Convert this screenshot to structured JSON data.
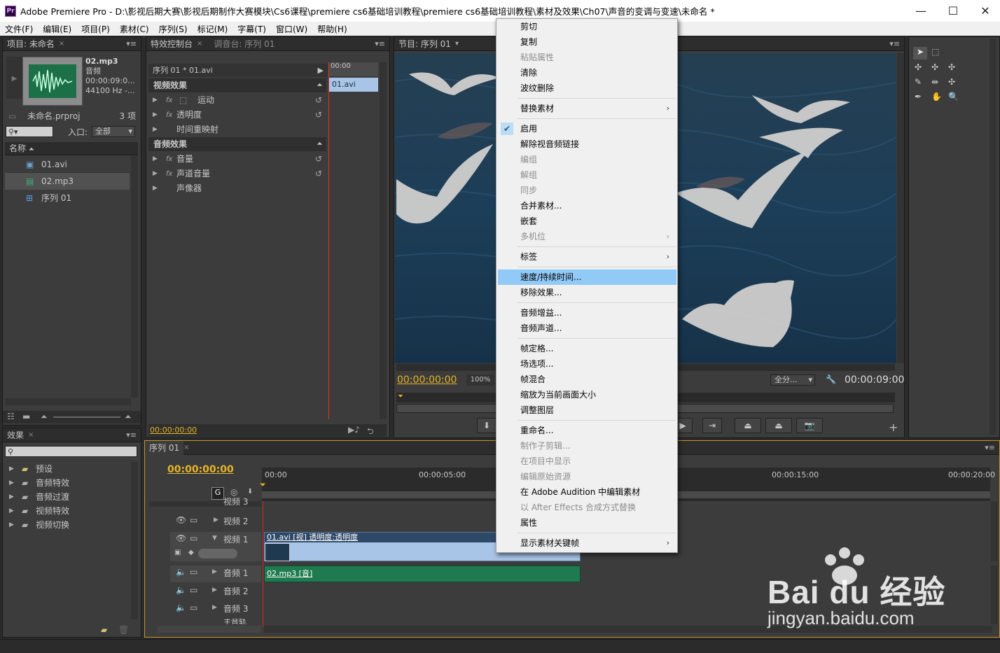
{
  "app": {
    "title": "Adobe Premiere Pro - D:\\影视后期大赛\\影视后期制作大赛模块\\Cs6课程\\premiere cs6基础培训教程\\premiere cs6基础培训教程\\素材及效果\\Ch07\\声音的变调与变速\\未命名 *",
    "logo": "Pr"
  },
  "menubar": [
    "文件(F)",
    "编辑(E)",
    "项目(P)",
    "素材(C)",
    "序列(S)",
    "标记(M)",
    "字幕(T)",
    "窗口(W)",
    "帮助(H)"
  ],
  "project_panel": {
    "tab": "项目: 未命名",
    "preview": {
      "name": "02.mp3",
      "type": "音频",
      "duration": "00:00:09:0...",
      "rate": "44100 Hz -..."
    },
    "project_file": "未命名.prproj",
    "item_count": "3 项",
    "entry_label": "入口:",
    "entry_value": "全部",
    "column_header": "名称",
    "items": [
      "01.avi",
      "02.mp3",
      "序列 01"
    ]
  },
  "effect_controls": {
    "tab": "特效控制台",
    "tab2": "调音台: 序列 01",
    "clip_path": "序列 01 * 01.avi",
    "timecode_ruler": "00:00",
    "clip_label": "01.avi",
    "video_header": "视频效果",
    "video_effects": [
      "运动",
      "透明度",
      "时间重映射"
    ],
    "audio_header": "音频效果",
    "audio_effects": [
      "音量",
      "声道音量",
      "声像器"
    ],
    "timecode": "00:00:00:00"
  },
  "program_monitor": {
    "tab": "节目: 序列 01",
    "timecode_left": "00:00:00:00",
    "zoom": "100%",
    "fit": "全分...",
    "timecode_right": "00:00:09:00"
  },
  "effects_panel": {
    "tab": "效果",
    "folders": [
      "预设",
      "音频特效",
      "音频过渡",
      "视频特效",
      "视频切换"
    ]
  },
  "timeline": {
    "tab": "序列 01",
    "timecode": "00:00:00:00",
    "ruler": [
      "00:00",
      "00:00:05:00",
      "00:00:15:00",
      "00:00:20:00"
    ],
    "tracks": [
      "视频 3",
      "视频 2",
      "视频 1",
      "音频 1",
      "音频 2",
      "音频 3",
      "主音轨"
    ],
    "video_clip": "01.avi [视] 透明度:透明度",
    "audio_clip": "02.mp3 [音]"
  },
  "context_menu": [
    {
      "label": "剪切",
      "enabled": true
    },
    {
      "label": "复制",
      "enabled": true
    },
    {
      "label": "粘贴属性",
      "enabled": false
    },
    {
      "label": "清除",
      "enabled": true
    },
    {
      "label": "波纹删除",
      "enabled": true
    },
    {
      "label": "替换素材",
      "enabled": true,
      "submenu": true
    },
    {
      "label": "启用",
      "enabled": true,
      "checked": true
    },
    {
      "label": "解除视音频链接",
      "enabled": true
    },
    {
      "label": "编组",
      "enabled": false
    },
    {
      "label": "解组",
      "enabled": false
    },
    {
      "label": "同步",
      "enabled": false
    },
    {
      "label": "合并素材...",
      "enabled": true
    },
    {
      "label": "嵌套",
      "enabled": true
    },
    {
      "label": "多机位",
      "enabled": false,
      "submenu": true
    },
    {
      "label": "标签",
      "enabled": true,
      "submenu": true
    },
    {
      "label": "速度/持续时间...",
      "enabled": true,
      "selected": true
    },
    {
      "label": "移除效果...",
      "enabled": true
    },
    {
      "label": "音频增益...",
      "enabled": true
    },
    {
      "label": "音频声道...",
      "enabled": true
    },
    {
      "label": "帧定格...",
      "enabled": true
    },
    {
      "label": "场选项...",
      "enabled": true
    },
    {
      "label": "帧混合",
      "enabled": true
    },
    {
      "label": "缩放为当前画面大小",
      "enabled": true
    },
    {
      "label": "调整图层",
      "enabled": true
    },
    {
      "label": "重命名...",
      "enabled": true
    },
    {
      "label": "制作子剪辑...",
      "enabled": false
    },
    {
      "label": "在项目中显示",
      "enabled": false
    },
    {
      "label": "编辑原始资源",
      "enabled": false
    },
    {
      "label": "在 Adobe Audition 中编辑素材",
      "enabled": true
    },
    {
      "label": "以 After Effects 合成方式替换",
      "enabled": false
    },
    {
      "label": "属性",
      "enabled": true
    },
    {
      "label": "显示素材关键帧",
      "enabled": true,
      "submenu": true
    }
  ],
  "watermark": {
    "brand": "Bai du 经验",
    "url": "jingyan.baidu.com"
  },
  "colors": {
    "timecode": "#e5b428",
    "menu_highlight": "#91c9f7",
    "video_clip": "#a8c4e6",
    "audio_clip": "#1f7a4f",
    "playhead": "#d22"
  }
}
